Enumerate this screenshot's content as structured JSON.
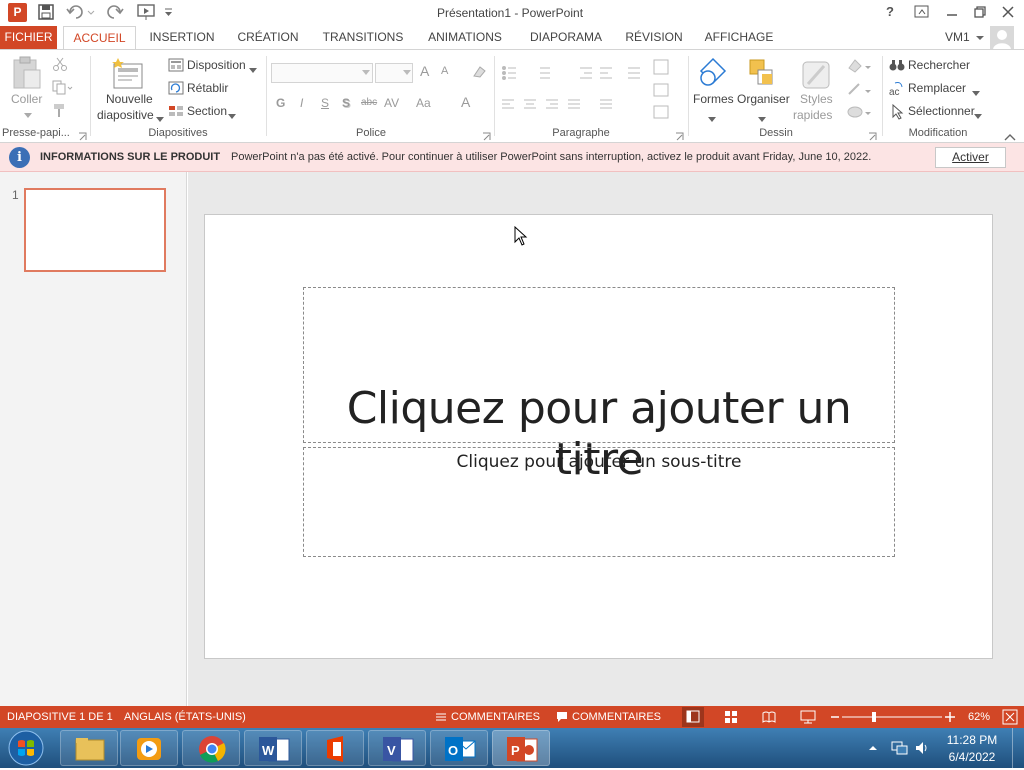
{
  "window": {
    "title": "Présentation1 - PowerPoint",
    "controls": {
      "help": "?"
    }
  },
  "tabs": [
    {
      "label": "FICHIER"
    },
    {
      "label": "ACCUEIL"
    },
    {
      "label": "INSERTION"
    },
    {
      "label": "CRÉATION"
    },
    {
      "label": "TRANSITIONS"
    },
    {
      "label": "ANIMATIONS"
    },
    {
      "label": "DIAPORAMA"
    },
    {
      "label": "RÉVISION"
    },
    {
      "label": "AFFICHAGE"
    }
  ],
  "user": {
    "name": "VM1"
  },
  "ribbon": {
    "clipboard": {
      "paste": "Coller",
      "group": "Presse-papi..."
    },
    "slides": {
      "new_line1": "Nouvelle",
      "new_line2": "diapositive",
      "layout": "Disposition",
      "reset": "Rétablir",
      "section": "Section",
      "group": "Diapositives"
    },
    "font": {
      "bold": "G",
      "italic": "I",
      "underline": "S",
      "shadow": "S",
      "strike": "abc",
      "spacing": "AV",
      "case": "Aa",
      "color": "A",
      "grow": "A",
      "shrink": "A",
      "group": "Police"
    },
    "paragraph": {
      "group": "Paragraphe"
    },
    "drawing": {
      "shapes": "Formes",
      "arrange": "Organiser",
      "styles_line1": "Styles",
      "styles_line2": "rapides",
      "group": "Dessin"
    },
    "editing": {
      "find": "Rechercher",
      "replace": "Remplacer",
      "select": "Sélectionner",
      "group": "Modification"
    }
  },
  "infobar": {
    "title": "INFORMATIONS SUR LE PRODUIT",
    "message": "PowerPoint n'a pas été activé. Pour continuer à utiliser PowerPoint sans interruption, activez le produit avant Friday, June 10, 2022.",
    "button": "Activer"
  },
  "thumbnails": [
    {
      "number": "1"
    }
  ],
  "slide": {
    "title_placeholder": "Cliquez pour ajouter un titre",
    "subtitle_placeholder": "Cliquez pour ajouter un sous-titre"
  },
  "status": {
    "slide_info": "DIAPOSITIVE 1 DE 1",
    "language": "ANGLAIS (ÉTATS-UNIS)",
    "notes": "COMMENTAIRES",
    "comments": "COMMENTAIRES",
    "zoom": "62%",
    "zoom_level": 0.62
  },
  "taskbar": {
    "time": "11:28 PM",
    "date": "6/4/2022"
  },
  "colors": {
    "accent": "#d24726",
    "info_bg": "#fce4e4",
    "taskbar": "#2b5f8f"
  }
}
